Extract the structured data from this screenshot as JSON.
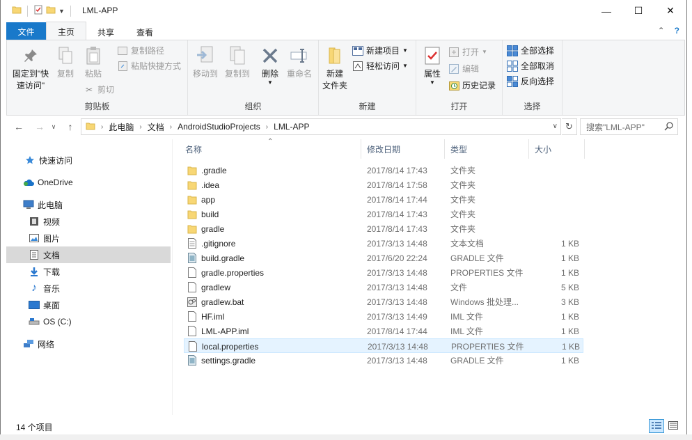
{
  "window": {
    "title": "LML-APP",
    "controls": {
      "minimize": "—",
      "maximize": "☐",
      "close": "✕"
    }
  },
  "tabs": {
    "file": "文件",
    "home": "主页",
    "share": "共享",
    "view": "查看"
  },
  "ribbon": {
    "clipboard": {
      "label": "剪贴板",
      "pin": "固定到\"快\n速访问\"",
      "copy": "复制",
      "paste": "粘贴",
      "copy_path": "复制路径",
      "paste_shortcut": "粘贴快捷方式",
      "cut": "剪切"
    },
    "organize": {
      "label": "组织",
      "move_to": "移动到",
      "copy_to": "复制到",
      "delete": "删除",
      "rename": "重命名"
    },
    "new": {
      "label": "新建",
      "new_folder": "新建\n文件夹",
      "new_item": "新建项目",
      "easy_access": "轻松访问"
    },
    "open": {
      "label": "打开",
      "properties": "属性",
      "open": "打开",
      "edit": "编辑",
      "history": "历史记录"
    },
    "select": {
      "label": "选择",
      "select_all": "全部选择",
      "select_none": "全部取消",
      "invert": "反向选择"
    }
  },
  "address": {
    "crumbs": [
      "此电脑",
      "文档",
      "AndroidStudioProjects",
      "LML-APP"
    ],
    "search_placeholder": "搜索\"LML-APP\""
  },
  "sidebar": {
    "items": [
      {
        "label": "快速访问",
        "icon": "star-icon"
      },
      {
        "label": "OneDrive",
        "icon": "cloud-icon"
      },
      {
        "label": "此电脑",
        "icon": "computer-icon"
      },
      {
        "label": "视频",
        "icon": "video-icon"
      },
      {
        "label": "图片",
        "icon": "picture-icon"
      },
      {
        "label": "文档",
        "icon": "document-icon"
      },
      {
        "label": "下载",
        "icon": "download-icon"
      },
      {
        "label": "音乐",
        "icon": "music-icon"
      },
      {
        "label": "桌面",
        "icon": "desktop-icon"
      },
      {
        "label": "OS (C:)",
        "icon": "drive-icon"
      },
      {
        "label": "网络",
        "icon": "network-icon"
      }
    ]
  },
  "columns": {
    "name": "名称",
    "date": "修改日期",
    "type": "类型",
    "size": "大小"
  },
  "files": [
    {
      "name": ".gradle",
      "date": "2017/8/14 17:43",
      "type": "文件夹",
      "size": "",
      "icon": "folder-icon"
    },
    {
      "name": ".idea",
      "date": "2017/8/14 17:58",
      "type": "文件夹",
      "size": "",
      "icon": "folder-icon"
    },
    {
      "name": "app",
      "date": "2017/8/14 17:44",
      "type": "文件夹",
      "size": "",
      "icon": "folder-icon"
    },
    {
      "name": "build",
      "date": "2017/8/14 17:43",
      "type": "文件夹",
      "size": "",
      "icon": "folder-icon"
    },
    {
      "name": "gradle",
      "date": "2017/8/14 17:43",
      "type": "文件夹",
      "size": "",
      "icon": "folder-icon"
    },
    {
      "name": ".gitignore",
      "date": "2017/3/13 14:48",
      "type": "文本文档",
      "size": "1 KB",
      "icon": "text-file-icon"
    },
    {
      "name": "build.gradle",
      "date": "2017/6/20 22:24",
      "type": "GRADLE 文件",
      "size": "1 KB",
      "icon": "gradle-file-icon"
    },
    {
      "name": "gradle.properties",
      "date": "2017/3/13 14:48",
      "type": "PROPERTIES 文件",
      "size": "1 KB",
      "icon": "file-icon"
    },
    {
      "name": "gradlew",
      "date": "2017/3/13 14:48",
      "type": "文件",
      "size": "5 KB",
      "icon": "file-icon"
    },
    {
      "name": "gradlew.bat",
      "date": "2017/3/13 14:48",
      "type": "Windows 批处理...",
      "size": "3 KB",
      "icon": "batch-file-icon"
    },
    {
      "name": "HF.iml",
      "date": "2017/3/13 14:49",
      "type": "IML 文件",
      "size": "1 KB",
      "icon": "file-icon"
    },
    {
      "name": "LML-APP.iml",
      "date": "2017/8/14 17:44",
      "type": "IML 文件",
      "size": "1 KB",
      "icon": "file-icon"
    },
    {
      "name": "local.properties",
      "date": "2017/3/13 14:48",
      "type": "PROPERTIES 文件",
      "size": "1 KB",
      "icon": "file-icon"
    },
    {
      "name": "settings.gradle",
      "date": "2017/3/13 14:48",
      "type": "GRADLE 文件",
      "size": "1 KB",
      "icon": "gradle-file-icon"
    }
  ],
  "status": {
    "count": "14 个项目"
  },
  "colors": {
    "accent": "#1979ca",
    "folder": "#f8d775",
    "selection": "#d9d9d9",
    "hover": "#e5f3ff"
  }
}
